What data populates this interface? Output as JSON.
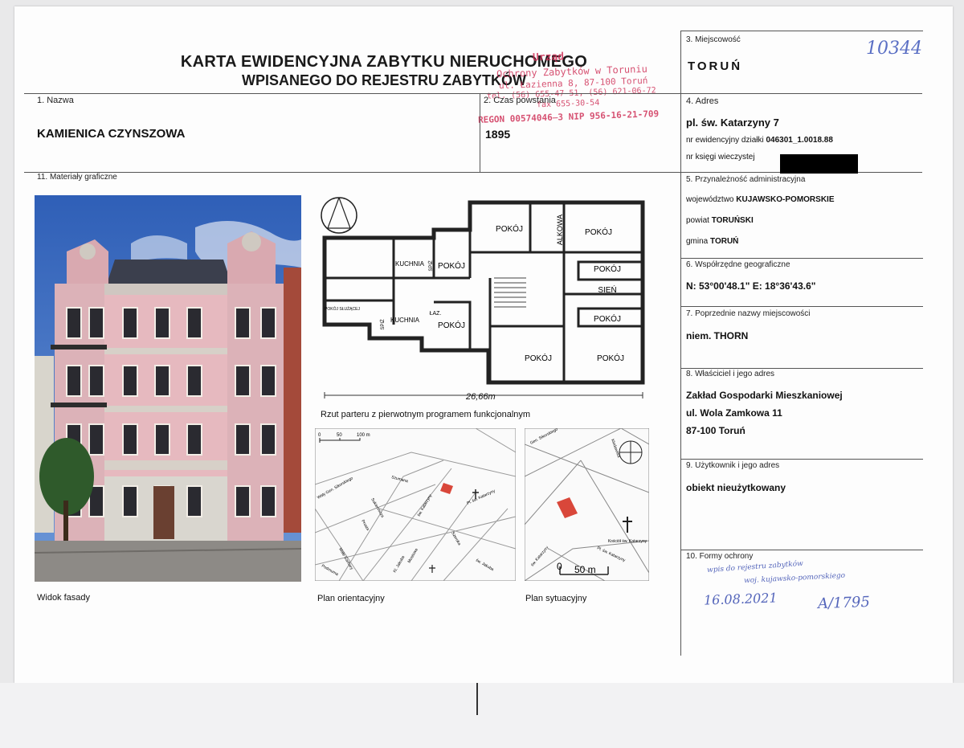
{
  "header": {
    "title_line1": "KARTA EWIDENCYJNA ZABYTKU NIERUCHOMEGO",
    "title_line2": "WPISANEGO DO REJESTRU ZABYTKÓW"
  },
  "archive_number": "10344",
  "stamp": {
    "line1": "Urząd",
    "line2": "Ochrony Zabytków w Toruniu",
    "line3": "ul. Łazienna 8, 87-100 Toruń",
    "line4": "tel. (56) 655-47-51, (56) 621-06-72",
    "line5": "fax 655-30-54",
    "line6": "REGON 00574046̶3 NIP 956-16-21-709"
  },
  "fields": {
    "nazwa_label": "1. Nazwa",
    "nazwa_value": "KAMIENICA CZYNSZOWA",
    "czas_label": "2. Czas powstania",
    "czas_value": "1895",
    "miejscowosc_label": "3. Miejscowość",
    "miejscowosc_value": "TORUŃ",
    "adres_label": "4. Adres",
    "adres_value": "pl. św. Katarzyny 7",
    "dzialka_label": "nr ewidencyjny działki",
    "dzialka_value": "046301_1.0018.88",
    "ksiega_label": "nr księgi wieczystej",
    "przynaleznosc_label": "5. Przynależność administracyjna",
    "wojewodztwo_label": "województwo",
    "wojewodztwo_value": "KUJAWSKO-POMORSKIE",
    "powiat_label": "powiat",
    "powiat_value": "TORUŃSKI",
    "gmina_label": "gmina",
    "gmina_value": "TORUŃ",
    "wspolrzedne_label": "6. Współrzędne geograficzne",
    "wspolrzedne_value": "N: 53°00'48.1\" E: 18°36'43.6\"",
    "poprzednie_label": "7. Poprzednie nazwy miejscowości",
    "poprzednie_value": "niem. THORN",
    "wlasciciel_label": "8. Właściciel i jego adres",
    "wlasciciel_line1": "Zakład Gospodarki Mieszkaniowej",
    "wlasciciel_line2": "ul. Wola Zamkowa 11",
    "wlasciciel_line3": "87-100 Toruń",
    "uzytkownik_label": "9. Użytkownik i jego adres",
    "uzytkownik_value": "obiekt nieużytkowany",
    "formy_label": "10. Formy ochrony",
    "materialy_label": "11. Materiały graficzne"
  },
  "handwritten": {
    "line1": "wpis do rejestru zabytków",
    "line2": "woj. kujawsko-pomorskiego",
    "date": "16.08.2021",
    "number": "A/1795"
  },
  "captions": {
    "facade": "Widok fasady",
    "plan_floor": "Rzut parteru z pierwotnym programem funkcjonalnym",
    "plan_orient": "Plan orientacyjny",
    "plan_site": "Plan sytuacyjny"
  },
  "floorplan": {
    "dimension": "26,66m",
    "rooms": {
      "pokoj": "POKÓJ",
      "alkowa": "ALKOWA",
      "kuchnia": "KUCHNIA",
      "sien": "SIEŃ",
      "laz": "ŁAZ.",
      "spiz": "SPIŻ",
      "pokoj_sluzacej": "POKÓJ SŁUŻĄCEJ"
    }
  },
  "orient_map": {
    "scale_0": "0",
    "scale_50": "50",
    "scale_100": "100 m",
    "streets": {
      "s1": "Wały Gen. Sikorskiego",
      "s2": "Szumana",
      "s3": "Sukiennicza",
      "s4": "Prosta",
      "s5": "Małe Garbary",
      "s6": "Podmurna",
      "s7": "św. Katarzyny",
      "s8": "Szeroka",
      "s9": "Pl. św. Katarzyny",
      "s10": "św. Jakuba",
      "s11": "Kl. Jakuba",
      "s12": "Mostowa"
    }
  },
  "site_map": {
    "scale_0": "0",
    "scale_50": "50 m",
    "church": "Kościół św. Katarzyny",
    "streets": {
      "s1": "Gen. Sikorskiego",
      "s2": "Kłodawska",
      "s3": "Pl. św. Katarzyny",
      "s4": "św. Katarzyny"
    }
  },
  "colors": {
    "rule": "#555555",
    "stamp": "#d0345a",
    "handwriting": "#5566bb",
    "building_red": "#d9473a",
    "sky": "#3c6cbf",
    "facade_pink": "#e8b8bd"
  }
}
